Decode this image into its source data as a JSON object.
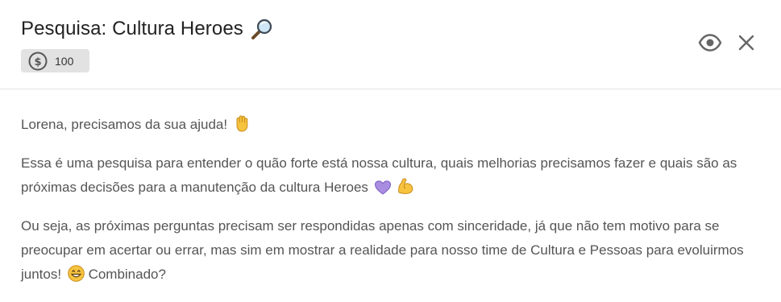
{
  "header": {
    "title": "Pesquisa: Cultura Heroes",
    "title_icon": "magnifying-glass-emoji",
    "points": "100",
    "points_icon": "dollar-coin-icon",
    "actions": [
      {
        "name": "preview",
        "icon": "eye-icon"
      },
      {
        "name": "close",
        "icon": "close-icon"
      }
    ]
  },
  "body": {
    "greeting": "Lorena, precisamos da sua ajuda!",
    "greeting_emoji": "raised-hand-emoji",
    "intro": "Essa é uma pesquisa para entender o quão forte está nossa cultura, quais melhorias precisamos fazer e quais são as próximas decisões para a manutenção da cultura Heroes",
    "intro_emojis": [
      "purple-heart-emoji",
      "flexed-biceps-emoji"
    ],
    "instructions": "Ou seja, as próximas perguntas precisam ser respondidas apenas com sinceridade, já que não tem motivo para se preocupar em acertar ou errar, mas sim em mostrar a realidade para nosso time de Cultura e Pessoas para evoluirmos juntos!",
    "instructions_emoji": "grinning-face-emoji",
    "closing": "Combinado?"
  },
  "colors": {
    "title": "#222222",
    "body_text": "#555555",
    "badge_bg": "#e2e2e2",
    "icon": "#666666",
    "divider": "#e3e3e3"
  }
}
